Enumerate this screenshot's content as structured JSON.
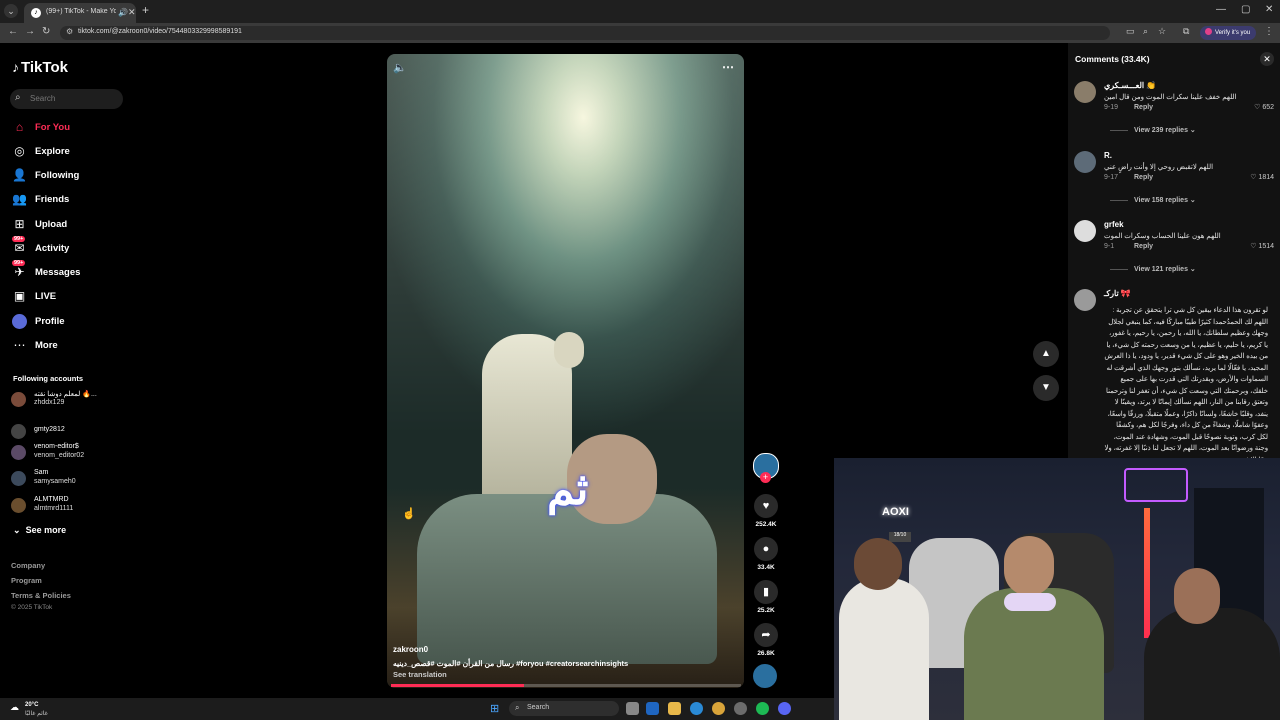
{
  "browser": {
    "tab_title": "(99+) TikTok - Make Your D...",
    "url": "tiktok.com/@zakroon0/video/7544803329998589191",
    "verify_label": "Verify it's you"
  },
  "sidebar": {
    "logo": "TikTok",
    "search_placeholder": "Search",
    "nav": [
      {
        "label": "For You",
        "icon": "home-icon"
      },
      {
        "label": "Explore",
        "icon": "compass-icon"
      },
      {
        "label": "Following",
        "icon": "following-icon"
      },
      {
        "label": "Friends",
        "icon": "friends-icon"
      },
      {
        "label": "Upload",
        "icon": "upload-icon"
      },
      {
        "label": "Activity",
        "icon": "activity-icon",
        "badge": "99+"
      },
      {
        "label": "Messages",
        "icon": "messages-icon",
        "badge": "99+"
      },
      {
        "label": "LIVE",
        "icon": "live-icon"
      },
      {
        "label": "Profile",
        "icon": "profile-avatar"
      },
      {
        "label": "More",
        "icon": "more-icon"
      }
    ],
    "following_title": "Following accounts",
    "accounts": [
      {
        "name": "لمعلم دوشا نقته 🔥...",
        "handle": "zhddx129"
      },
      {
        "name": "gmty2812",
        "handle": ""
      },
      {
        "name": "venom-editor$",
        "handle": "venom_editor02"
      },
      {
        "name": "Sam",
        "handle": "samysameh0"
      },
      {
        "name": "ALMTMRD",
        "handle": "almtmrd1111"
      }
    ],
    "see_more": "See more",
    "footer": [
      "Company",
      "Program",
      "Terms & Policies"
    ],
    "copyright": "© 2025 TikTok"
  },
  "video": {
    "overlay_caption": "ثم",
    "author": "zakroon0",
    "description": "رسال من القرأن #الموت #قصص_دينيه #foryou #creatorsearchinsights",
    "see_translation": "See translation",
    "progress": 0.38
  },
  "actions": {
    "likes": "252.4K",
    "comments": "33.4K",
    "saves": "25.2K",
    "shares": "26.8K"
  },
  "comments": {
    "header": "Comments (33.4K)",
    "items": [
      {
        "user": "العـــسـكري 👏",
        "text": "اللهم خفف علينا سكرات الموت ومن قال امين",
        "date": "9-19",
        "reply": "Reply",
        "likes": "652",
        "view": "View 239 replies"
      },
      {
        "user": "R.",
        "text": "اللهم لاتقبض روحي إلا وأنت راضٍ عني",
        "date": "9-17",
        "reply": "Reply",
        "likes": "1814",
        "view": "View 158 replies"
      },
      {
        "user": "grfek",
        "text": "اللهم هون علينا الحساب وسكرات الموت",
        "date": "9-1",
        "reply": "Reply",
        "likes": "1514",
        "view": "View 121 replies"
      }
    ],
    "long_user": "تاركـ 🎀",
    "long_text": "لو تقرون هذا الدعاء بيقين كل شي ترا يتحقق عن تجربة : اللهم لك الحمدُحمدا كثيرًا طيبًا مباركًا فيه، كما ينبغي لجلال وجهك وعظيم سلطانك، يا الله، يا رحمن، يا رحيم، يا غفور، يا كريم، يا حليم، يا عظيم، يا من وسعت رحمته كل شيء، يا من بيده الخير وهو على كل شيء قدير، يا ودود، يا ذا العرش المجيد، يا فعّالًا لما يريد، نسألك بنور وجهك الذي أشرقت له السماوات والأرض، وبقدرتك التي قدرت بها على جميع خلقك، وبرحمتك التي وسعت كل شيء، أن تغفر لنا وترحمنا وتعتق رقابنا من النار، اللهم نسألك إيمانًا لا يرتد، ويقينًا لا ينفد، وقلبًا خاشعًا، ولسانًا ذاكرًا، وعملًا متقبلًا، ورزقًا واسعًا، وعفوًا شاملًا، وشفاءً من كل داء، وفرجًا لكل هم، وكشفًا لكل كرب، وتوبة نصوحًا قبل الموت، وشهادة عند الموت، وجنة ورضوانًا بعد الموت، اللهم لا تجعل لنا ذنبًا إلا غفرته، ولا همًا إلا فرجته"
  },
  "webcam": {
    "sign": "AOXI",
    "screen": "18/10"
  },
  "taskbar": {
    "temp": "20°C",
    "weather": "غائم غالبًا",
    "search": "Search"
  }
}
